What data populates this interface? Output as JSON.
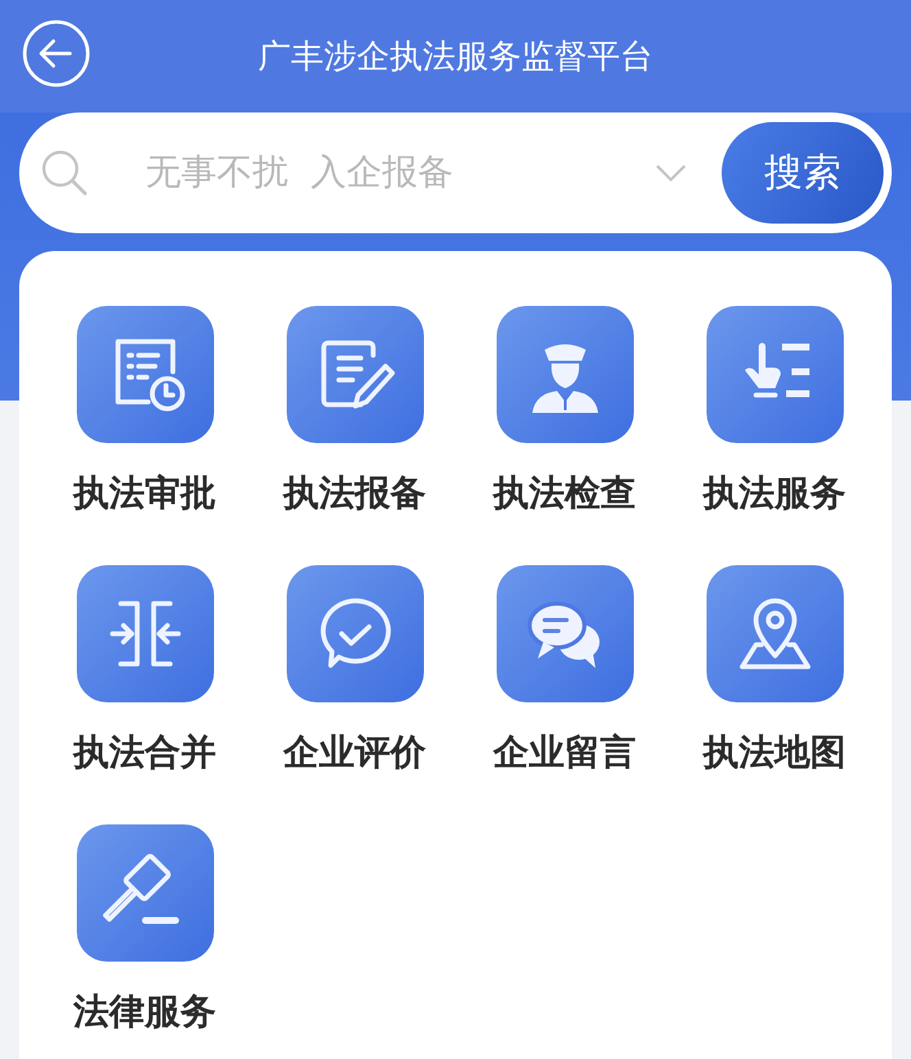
{
  "header": {
    "title": "广丰涉企执法服务监督平台"
  },
  "search": {
    "placeholder": "无事不扰  入企报备",
    "button": "搜索"
  },
  "services": [
    {
      "label": "执法审批"
    },
    {
      "label": "执法报备"
    },
    {
      "label": "执法检查"
    },
    {
      "label": "执法服务"
    },
    {
      "label": "执法合并"
    },
    {
      "label": "企业评价"
    },
    {
      "label": "企业留言"
    },
    {
      "label": "执法地图"
    },
    {
      "label": "法律服务"
    }
  ]
}
